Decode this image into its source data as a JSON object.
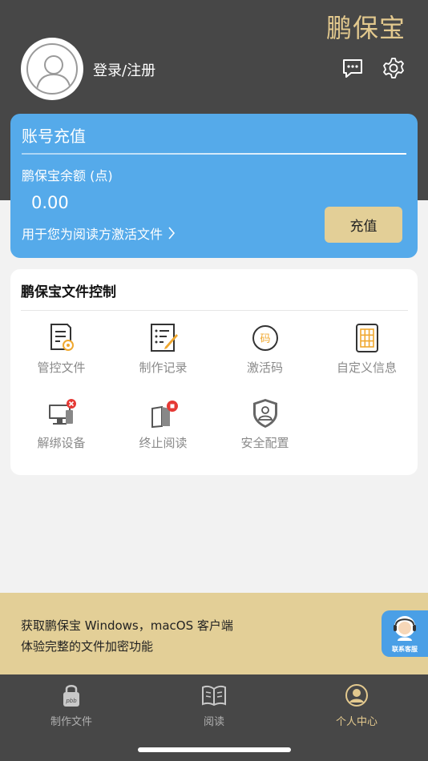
{
  "header": {
    "brand": "鹏保宝",
    "login_text": "登录/注册",
    "icons": [
      "avatar-icon",
      "message-icon",
      "settings-icon"
    ]
  },
  "recharge": {
    "title": "账号充值",
    "balance_label": "鹏保宝余额 (点)",
    "balance": "0.00",
    "link_text": "用于您为阅读方激活文件",
    "button": "充值"
  },
  "control": {
    "title": "鹏保宝文件控制",
    "items": [
      {
        "label": "管控文件",
        "icon": "document-gear-icon"
      },
      {
        "label": "制作记录",
        "icon": "record-edit-icon"
      },
      {
        "label": "激活码",
        "icon": "activation-code-icon"
      },
      {
        "label": "自定义信息",
        "icon": "grid-sheet-icon"
      },
      {
        "label": "解绑设备",
        "icon": "unbind-device-icon"
      },
      {
        "label": "终止阅读",
        "icon": "stop-reading-icon"
      },
      {
        "label": "安全配置",
        "icon": "security-shield-icon"
      }
    ],
    "code_glyph": "码"
  },
  "promo": {
    "line1": "获取鹏保宝 Windows，macOS 客户端",
    "line2": "体验完整的文件加密功能",
    "service_label": "联系客服"
  },
  "tabbar": {
    "items": [
      {
        "label": "制作文件",
        "icon": "lock-pbb-icon",
        "active": false
      },
      {
        "label": "阅读",
        "icon": "book-icon",
        "active": false
      },
      {
        "label": "个人中心",
        "icon": "person-icon",
        "active": true
      }
    ],
    "lock_text": "pbb"
  },
  "colors": {
    "header_bg": "#474747",
    "accent_gold": "#e3c98e",
    "card_blue": "#55aaea",
    "button_gold": "#e3cf97",
    "icon_orange": "#f0a830",
    "badge_red": "#e53935"
  }
}
